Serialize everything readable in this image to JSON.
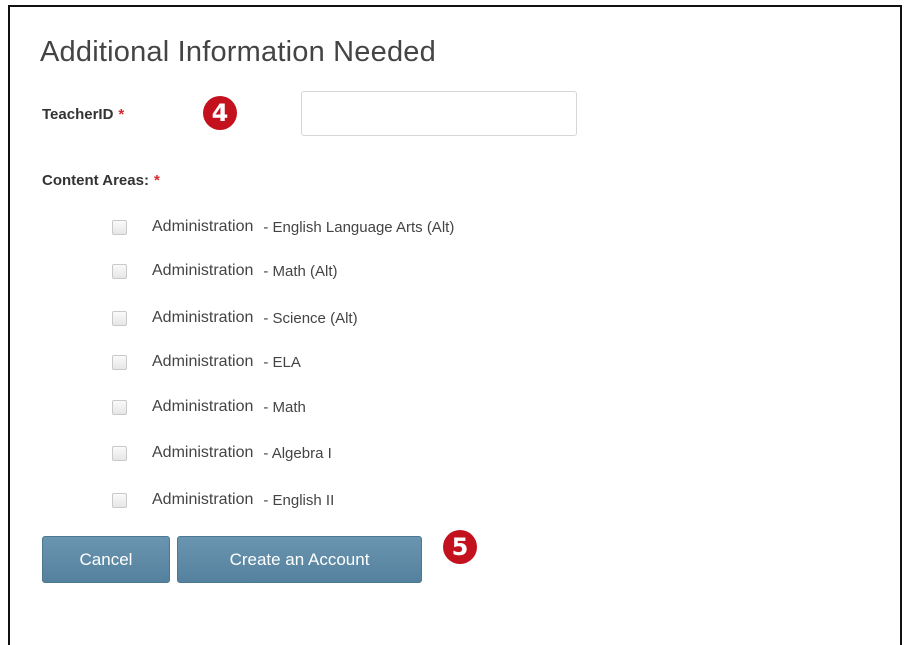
{
  "form": {
    "title": "Additional Information Needed",
    "teacher_id": {
      "label": "TeacherID",
      "required_mark": "*",
      "value": "",
      "placeholder": ""
    },
    "content_areas": {
      "label": "Content Areas:",
      "required_mark": "*",
      "options": [
        {
          "prefix": "Administration",
          "area": "- English Language Arts (Alt)",
          "checked": false
        },
        {
          "prefix": "Administration",
          "area": "- Math (Alt)",
          "checked": false
        },
        {
          "prefix": "Administration",
          "area": "- Science (Alt)",
          "checked": false
        },
        {
          "prefix": "Administration",
          "area": "- ELA",
          "checked": false
        },
        {
          "prefix": "Administration",
          "area": "- Math",
          "checked": false
        },
        {
          "prefix": "Administration",
          "area": "- Algebra I",
          "checked": false
        },
        {
          "prefix": "Administration",
          "area": "- English II",
          "checked": false
        }
      ]
    },
    "buttons": {
      "cancel_label": "Cancel",
      "create_label": "Create an Account"
    }
  },
  "callouts": {
    "step4": "4",
    "step5": "5"
  },
  "colors": {
    "required": "#d9262c",
    "button_bg": "#5f8ba8",
    "callout_bg": "#c3121e"
  }
}
